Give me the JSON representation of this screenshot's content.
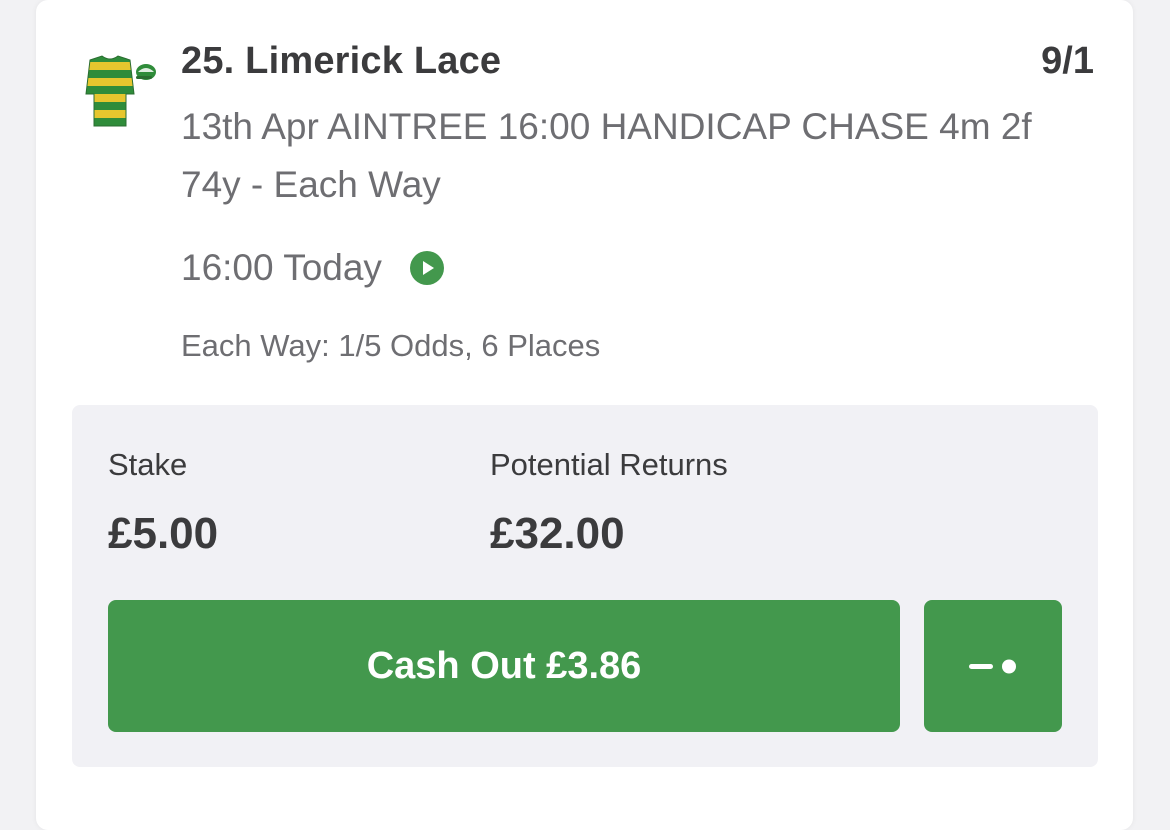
{
  "selection": {
    "title": "25. Limerick Lace",
    "odds": "9/1",
    "race_description": "13th Apr AINTREE 16:00 HANDICAP CHASE 4m 2f 74y - Each Way",
    "time": "16:00 Today",
    "each_way_terms": "Each Way: 1/5 Odds, 6 Places",
    "silks_icon": "jockey-silks-green-gold-hoops",
    "live_icon": "play-icon"
  },
  "bet": {
    "stake_label": "Stake",
    "stake_value": "£5.00",
    "returns_label": "Potential Returns",
    "returns_value": "£32.00",
    "cashout_label": "Cash Out £3.86",
    "partial_cashout_icon": "slider-icon"
  },
  "colors": {
    "accent_green": "#43984d",
    "silks_green": "#2f8c3a",
    "silks_gold": "#e6c62e",
    "text_dark": "#3b3b3d",
    "text_muted": "#6e6e72",
    "panel_bg": "#f1f1f5"
  }
}
